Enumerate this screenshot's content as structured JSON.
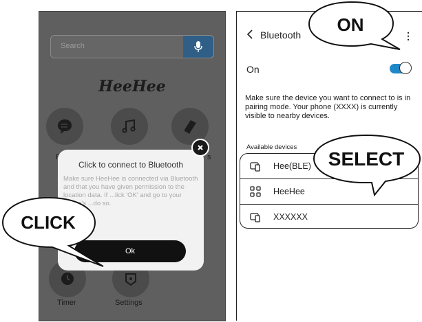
{
  "left_screen": {
    "search": {
      "placeholder": "Search",
      "mic_icon": "mic-icon"
    },
    "brand": "HeeHee",
    "grid": [
      {
        "icon": "chat-bubble-icon",
        "label": "P"
      },
      {
        "icon": "music-note-icon",
        "label": ""
      },
      {
        "icon": "book-icon",
        "label": "s"
      },
      {
        "icon": "clock-icon",
        "label": "Timer"
      },
      {
        "icon": "settings-icon",
        "label": "Settings"
      }
    ],
    "dialog": {
      "title": "Click to connect to Bluetooth",
      "body": "Make sure HeeHee is connected via Bluetooth and that you have given permission to the location data. If ...lick 'OK' and go to your phone's ...do so.",
      "ok_label": "Ok"
    }
  },
  "right_screen": {
    "header": {
      "title": "Bluetooth",
      "more_icon": "kebab-menu-icon"
    },
    "on_label": "On",
    "toggle_on": true,
    "description": "Make sure the device you want to connect to is in pairing mode. Your phone (XXXX) is currently visible to nearby devices.",
    "available_label": "Available devices",
    "devices": [
      {
        "name": "Hee(BLE)",
        "icon": "device-icon"
      },
      {
        "name": "HeeHee",
        "icon": "grid-device-icon"
      },
      {
        "name": "XXXXXX",
        "icon": "device-icon"
      }
    ]
  },
  "callouts": {
    "click": "CLICK",
    "on": "ON",
    "select": "SELECT"
  },
  "colors": {
    "toggle": "#1e88c8",
    "mic_button": "#2f5f86",
    "overlay": "#5f5f5f"
  }
}
